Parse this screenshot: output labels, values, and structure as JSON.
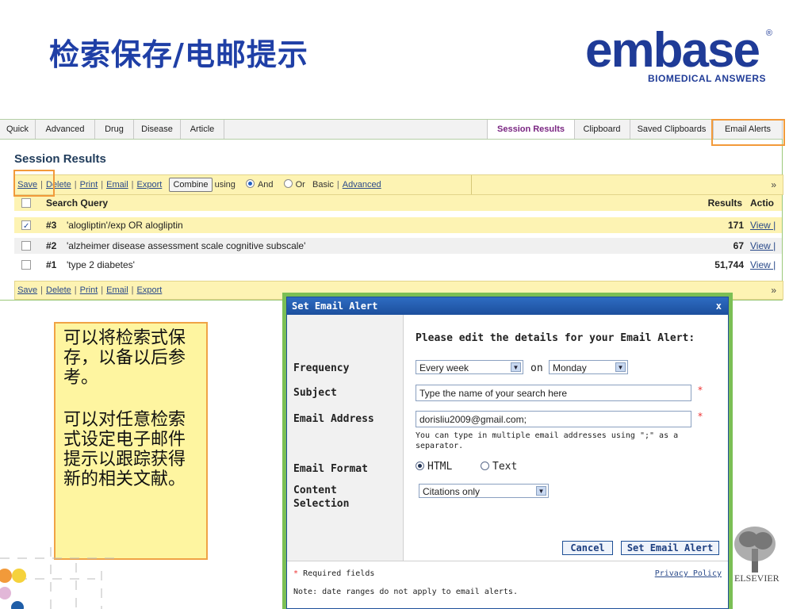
{
  "slide": {
    "title": "检索保存/电邮提示",
    "logo": {
      "word": "embase",
      "registered": "®",
      "tagline": "BIOMEDICAL ANSWERS"
    },
    "note": {
      "paragraph1": "可以将检索式保存，以备以后参考。",
      "paragraph2": "可以对任意检索式设定电子邮件提示以跟踪获得新的相关文献。"
    },
    "publisher": "ELSEVIER",
    "colors": {
      "title": "#1f3fa6",
      "highlight": "#f29a3a",
      "note_bg": "#fef5a0",
      "dialog_border": "#7bbf55"
    }
  },
  "nav": {
    "left_tabs": [
      "Quick",
      "Advanced",
      "Drug",
      "Disease",
      "Article"
    ],
    "right_tabs": [
      "Session Results",
      "Clipboard",
      "Saved Clipboards",
      "Email Alerts"
    ],
    "active_tab": "Session Results"
  },
  "session": {
    "title": "Session Results",
    "toolbar": {
      "save": "Save",
      "delete": "Delete",
      "print": "Print",
      "email": "Email",
      "export": "Export",
      "combine": "Combine",
      "using": "using",
      "and": "And",
      "or": "Or",
      "basic": "Basic",
      "advanced": "Advanced",
      "collapse_icon": "double-chevron-down"
    },
    "columns": {
      "query": "Search Query",
      "results": "Results",
      "action": "Actio"
    },
    "rows": [
      {
        "num": "#3",
        "query": "'alogliptin'/exp OR alogliptin",
        "results": "171",
        "action": "View |",
        "checked": true
      },
      {
        "num": "#2",
        "query": "'alzheimer disease assessment scale cognitive subscale'",
        "results": "67",
        "action": "View |",
        "checked": false
      },
      {
        "num": "#1",
        "query": "'type 2 diabetes'",
        "results": "51,744",
        "action": "View |",
        "checked": false
      }
    ]
  },
  "dialog": {
    "title": "Set Email Alert",
    "close": "x",
    "heading": "Please edit the details for your Email Alert:",
    "labels": {
      "frequency": "Frequency",
      "subject": "Subject",
      "email": "Email Address",
      "format": "Email Format",
      "content1": "Content",
      "content2": "Selection"
    },
    "frequency_value": "Every week",
    "on": "on",
    "day_value": "Monday",
    "subject_value": "Type the name of your search here",
    "email_value": "dorisliu2009@gmail.com;",
    "hint": "You can type in multiple email addresses using \";\" as a separator.",
    "format_html": "HTML",
    "format_text": "Text",
    "content_value": "Citations only",
    "cancel": "Cancel",
    "submit": "Set Email Alert",
    "required_note": "Required fields",
    "asterisk": "*",
    "privacy": "Privacy Policy",
    "date_note": "Note: date ranges do not apply to email alerts."
  }
}
